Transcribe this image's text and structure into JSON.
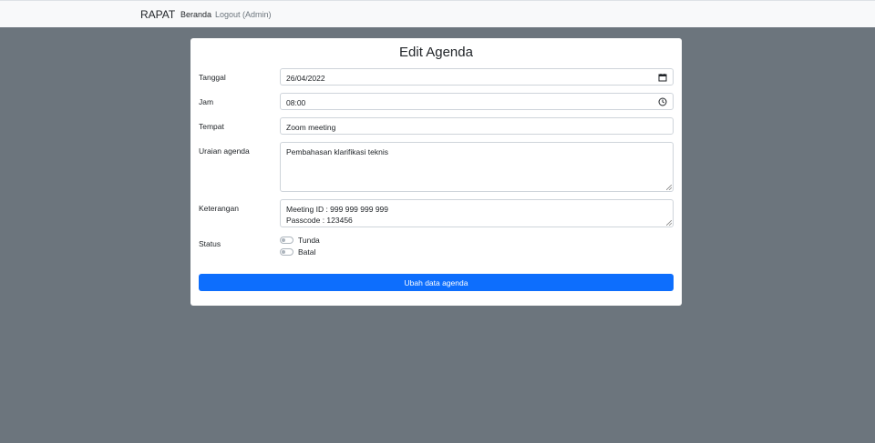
{
  "navbar": {
    "brand": "RAPAT",
    "links": [
      "Beranda",
      "Logout (Admin)"
    ]
  },
  "form": {
    "title": "Edit Agenda",
    "fields": {
      "tanggal": {
        "label": "Tanggal",
        "value": "26/04/2022",
        "icon": "calendar-icon"
      },
      "jam": {
        "label": "Jam",
        "value": "08:00",
        "icon": "clock-icon"
      },
      "tempat": {
        "label": "Tempat",
        "value": "Zoom meeting"
      },
      "uraian": {
        "label": "Uraian agenda",
        "value": "Pembahasan klarifikasi teknis"
      },
      "keterangan": {
        "label": "Keterangan",
        "lines": [
          "Meeting ID : 999 999 999 999",
          "Passcode : 123456"
        ]
      }
    },
    "status": {
      "label": "Status",
      "options": [
        {
          "label": "Tunda",
          "checked": false
        },
        {
          "label": "Batal",
          "checked": false
        }
      ]
    },
    "submit_label": "Ubah data agenda"
  },
  "colors": {
    "background": "#6c757d",
    "navbar": "#f8f9fa",
    "primary": "#0d6efd"
  }
}
